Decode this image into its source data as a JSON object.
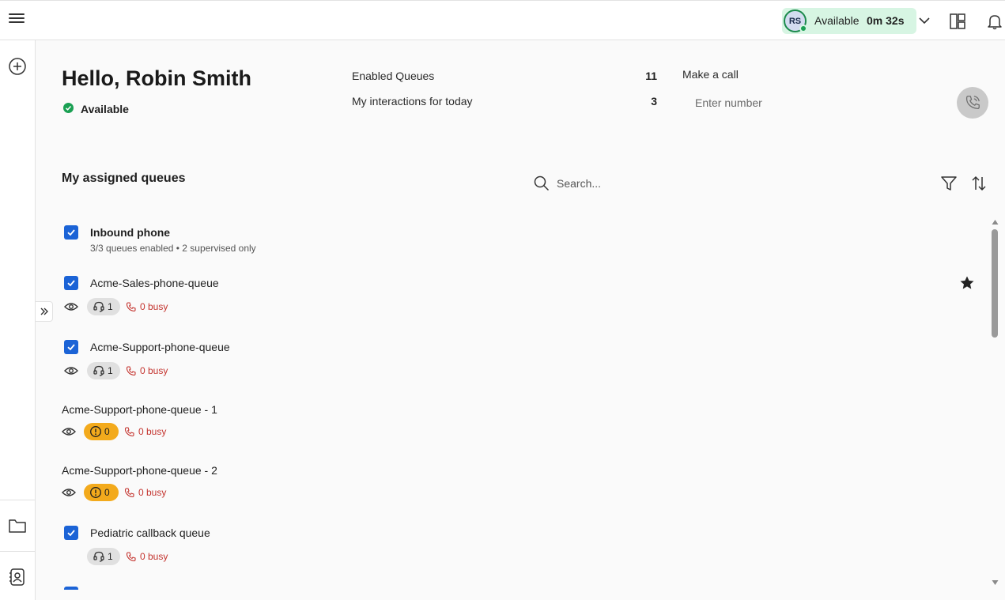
{
  "header": {
    "agent_initials": "RS",
    "status_label": "Available",
    "status_timer": "0m 32s",
    "colors": {
      "status_bg": "#d7f5e3",
      "status_green": "#1aa053",
      "accent_blue": "#1b63d6"
    }
  },
  "greeting": {
    "title": "Hello, Robin Smith",
    "status": "Available"
  },
  "stats": [
    {
      "label": "Enabled Queues",
      "value": "11"
    },
    {
      "label": "My interactions for today",
      "value": "3"
    }
  ],
  "make_call": {
    "title": "Make a call",
    "placeholder": "Enter number"
  },
  "queues": {
    "title": "My assigned queues",
    "search_placeholder": "Search...",
    "group": {
      "title": "Inbound phone",
      "subtitle": "3/3 queues enabled • 2 supervised only"
    },
    "items": [
      {
        "name": "Acme-Sales-phone-queue",
        "checked": true,
        "count": "1",
        "busy": "0 busy",
        "chip": "agents",
        "favorite": true
      },
      {
        "name": "Acme-Support-phone-queue",
        "checked": true,
        "count": "1",
        "busy": "0 busy",
        "chip": "agents"
      },
      {
        "name": "Acme-Support-phone-queue - 1",
        "checked": false,
        "count": "0",
        "busy": "0 busy",
        "chip": "warning"
      },
      {
        "name": "Acme-Support-phone-queue - 2",
        "checked": false,
        "count": "0",
        "busy": "0 busy",
        "chip": "warning"
      },
      {
        "name": "Pediatric callback queue",
        "checked": true,
        "count": "1",
        "busy": "0 busy",
        "chip": "agents"
      }
    ]
  },
  "icons": [
    "menu-icon",
    "chevron-down-icon",
    "layout-icon",
    "bell-icon",
    "add-circle-icon",
    "folder-icon",
    "contact-card-icon",
    "expand-icon",
    "check-circle-icon",
    "phone-icon",
    "search-icon",
    "filter-icon",
    "sort-icon",
    "checkbox-icon",
    "eye-icon",
    "headset-icon",
    "alert-circle-icon",
    "star-icon"
  ]
}
